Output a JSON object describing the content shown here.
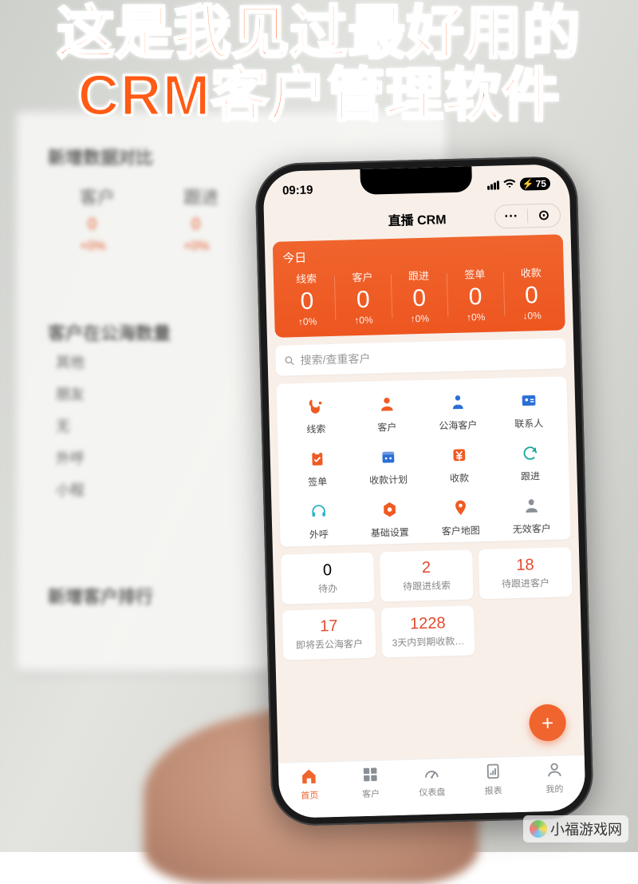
{
  "overlay": {
    "headline": "这是我见过最好用的CRM客户管理软件"
  },
  "bg": {
    "section1_title": "新增数据对比",
    "col1": "客户",
    "col2": "跟进",
    "val1": "0",
    "val2": "0",
    "pct1": "+0%",
    "pct2": "+0%",
    "section2_title": "客户在公海数量",
    "rows": [
      "其他",
      "朋友",
      "无",
      "外呼",
      "小程"
    ],
    "section3_title": "新增客户排行"
  },
  "status": {
    "time": "09:19",
    "battery": "75"
  },
  "nav": {
    "title": "直播 CRM",
    "menu": "···",
    "target": "⊙"
  },
  "today": {
    "label": "今日",
    "items": [
      {
        "label": "线索",
        "value": "0",
        "delta": "0%",
        "dir": "up"
      },
      {
        "label": "客户",
        "value": "0",
        "delta": "0%",
        "dir": "up"
      },
      {
        "label": "跟进",
        "value": "0",
        "delta": "0%",
        "dir": "up"
      },
      {
        "label": "签单",
        "value": "0",
        "delta": "0%",
        "dir": "up"
      },
      {
        "label": "收款",
        "value": "0",
        "delta": "0%",
        "dir": "down"
      }
    ]
  },
  "search": {
    "placeholder": "搜索/查重客户"
  },
  "grid": [
    {
      "label": "线索",
      "icon": "stethoscope",
      "color": "#f05a22"
    },
    {
      "label": "客户",
      "icon": "person",
      "color": "#f05a22"
    },
    {
      "label": "公海客户",
      "icon": "person-tie",
      "color": "#2a6fd6"
    },
    {
      "label": "联系人",
      "icon": "id-card",
      "color": "#2a6fd6"
    },
    {
      "label": "签单",
      "icon": "clipboard-check",
      "color": "#f05a22"
    },
    {
      "label": "收款计划",
      "icon": "calendar",
      "color": "#2a6fd6"
    },
    {
      "label": "收款",
      "icon": "cny",
      "color": "#f05a22"
    },
    {
      "label": "跟进",
      "icon": "refresh",
      "color": "#17a89b"
    },
    {
      "label": "外呼",
      "icon": "headset",
      "color": "#2ab3c7"
    },
    {
      "label": "基础设置",
      "icon": "gear-hex",
      "color": "#f05a22"
    },
    {
      "label": "客户地图",
      "icon": "pin",
      "color": "#f05a22"
    },
    {
      "label": "无效客户",
      "icon": "person-x",
      "color": "#8a8f95"
    }
  ],
  "cards": [
    {
      "value": "0",
      "label": "待办",
      "red": false
    },
    {
      "value": "2",
      "label": "待跟进线索",
      "red": true
    },
    {
      "value": "18",
      "label": "待跟进客户",
      "red": true
    },
    {
      "value": "17",
      "label": "即将丢公海客户",
      "red": true
    },
    {
      "value": "1228",
      "label": "3天内到期收款…",
      "red": true
    }
  ],
  "fab": {
    "label": "+"
  },
  "tabs": [
    {
      "label": "首页",
      "icon": "home",
      "active": true
    },
    {
      "label": "客户",
      "icon": "grid",
      "active": false
    },
    {
      "label": "仪表盘",
      "icon": "gauge",
      "active": false
    },
    {
      "label": "报表",
      "icon": "report",
      "active": false
    },
    {
      "label": "我的",
      "icon": "user",
      "active": false
    }
  ],
  "watermark": "小福游戏网"
}
